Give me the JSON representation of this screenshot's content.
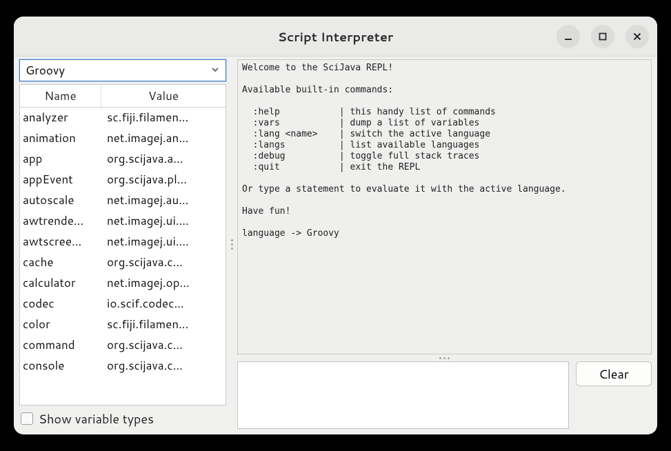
{
  "window": {
    "title": "Script Interpreter"
  },
  "combo": {
    "selected": "Groovy"
  },
  "table": {
    "headers": {
      "name": "Name",
      "value": "Value"
    },
    "rows": [
      {
        "name": "analyzer",
        "value": "sc.fiji.filamen..."
      },
      {
        "name": "animation",
        "value": "net.imagej.an..."
      },
      {
        "name": "app",
        "value": "org.scijava.a..."
      },
      {
        "name": "appEvent",
        "value": "org.scijava.pl..."
      },
      {
        "name": "autoscale",
        "value": "net.imagej.au..."
      },
      {
        "name": "awtrende...",
        "value": "net.imagej.ui...."
      },
      {
        "name": "awtscree...",
        "value": "net.imagej.ui...."
      },
      {
        "name": "cache",
        "value": "org.scijava.c..."
      },
      {
        "name": "calculator",
        "value": "net.imagej.op..."
      },
      {
        "name": "codec",
        "value": "io.scif.codec..."
      },
      {
        "name": "color",
        "value": "sc.fiji.filamen..."
      },
      {
        "name": "command",
        "value": "org.scijava.c..."
      },
      {
        "name": "console",
        "value": "org.scijava.c..."
      }
    ]
  },
  "show_types_label": "Show variable types",
  "show_types_checked": false,
  "output": "Welcome to the SciJava REPL!\n\nAvailable built-in commands:\n\n  :help           | this handy list of commands\n  :vars           | dump a list of variables\n  :lang <name>    | switch the active language\n  :langs          | list available languages\n  :debug          | toggle full stack traces\n  :quit           | exit the REPL\n\nOr type a statement to evaluate it with the active language.\n\nHave fun!\n\nlanguage -> Groovy",
  "input_value": "",
  "clear_label": "Clear"
}
